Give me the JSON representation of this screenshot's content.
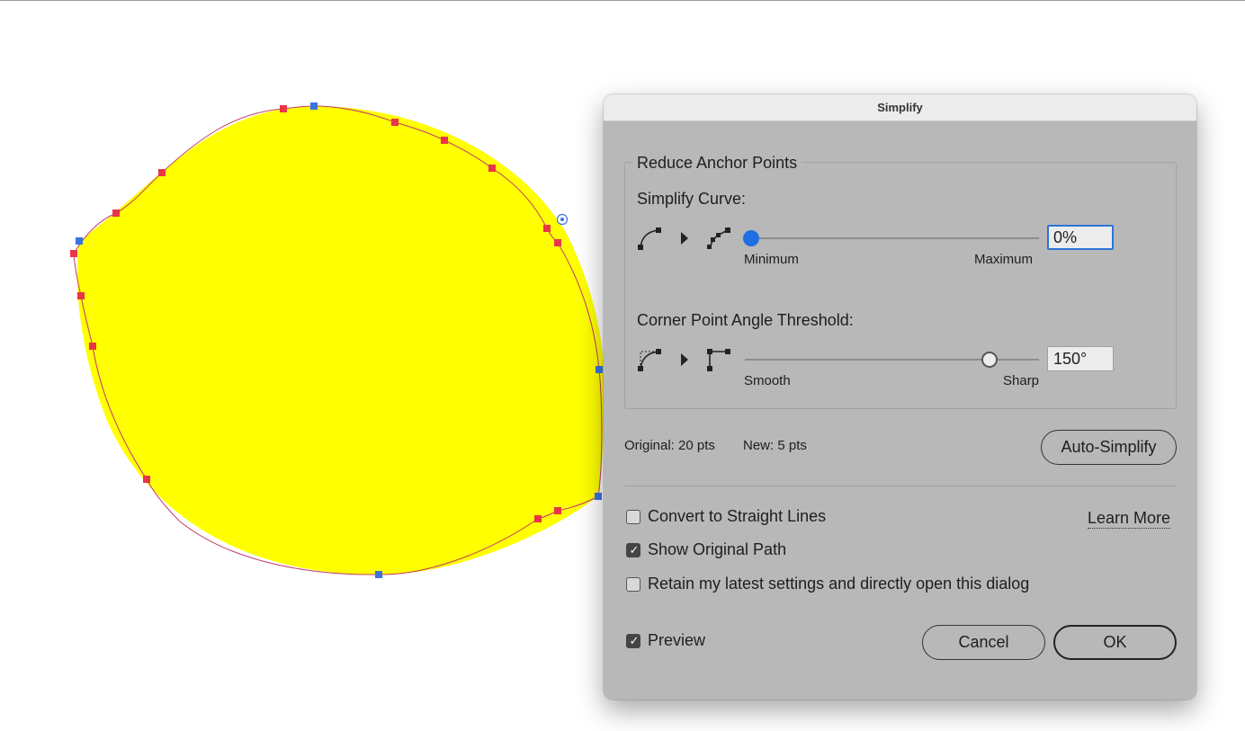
{
  "dialog": {
    "title": "Simplify",
    "group_title": "Reduce Anchor Points",
    "simplify_curve": {
      "label": "Simplify Curve:",
      "min_label": "Minimum",
      "max_label": "Maximum",
      "value": "0%",
      "level": 0
    },
    "corner_angle": {
      "label": "Corner Point Angle Threshold:",
      "min_label": "Smooth",
      "max_label": "Sharp",
      "value": "150°",
      "level": 0.8333
    },
    "stats": {
      "original": "Original: 20 pts",
      "new": "New: 5 pts"
    },
    "auto_simplify_label": "Auto-Simplify",
    "options": {
      "straight_lines": {
        "label": "Convert to Straight Lines",
        "checked": false
      },
      "show_original": {
        "label": "Show Original Path",
        "checked": true
      },
      "retain_settings": {
        "label": "Retain my latest settings and directly open this dialog",
        "checked": false
      }
    },
    "learn_more_label": "Learn More",
    "preview": {
      "label": "Preview",
      "checked": true
    },
    "cancel_label": "Cancel",
    "ok_label": "OK"
  },
  "colors": {
    "shape_fill": "#ffff00",
    "path_stroke": "#c23a6a",
    "anchor_point": "#e8354a",
    "selected_anchor": "#3b73e3",
    "slider_accent": "#1f6fe3"
  }
}
